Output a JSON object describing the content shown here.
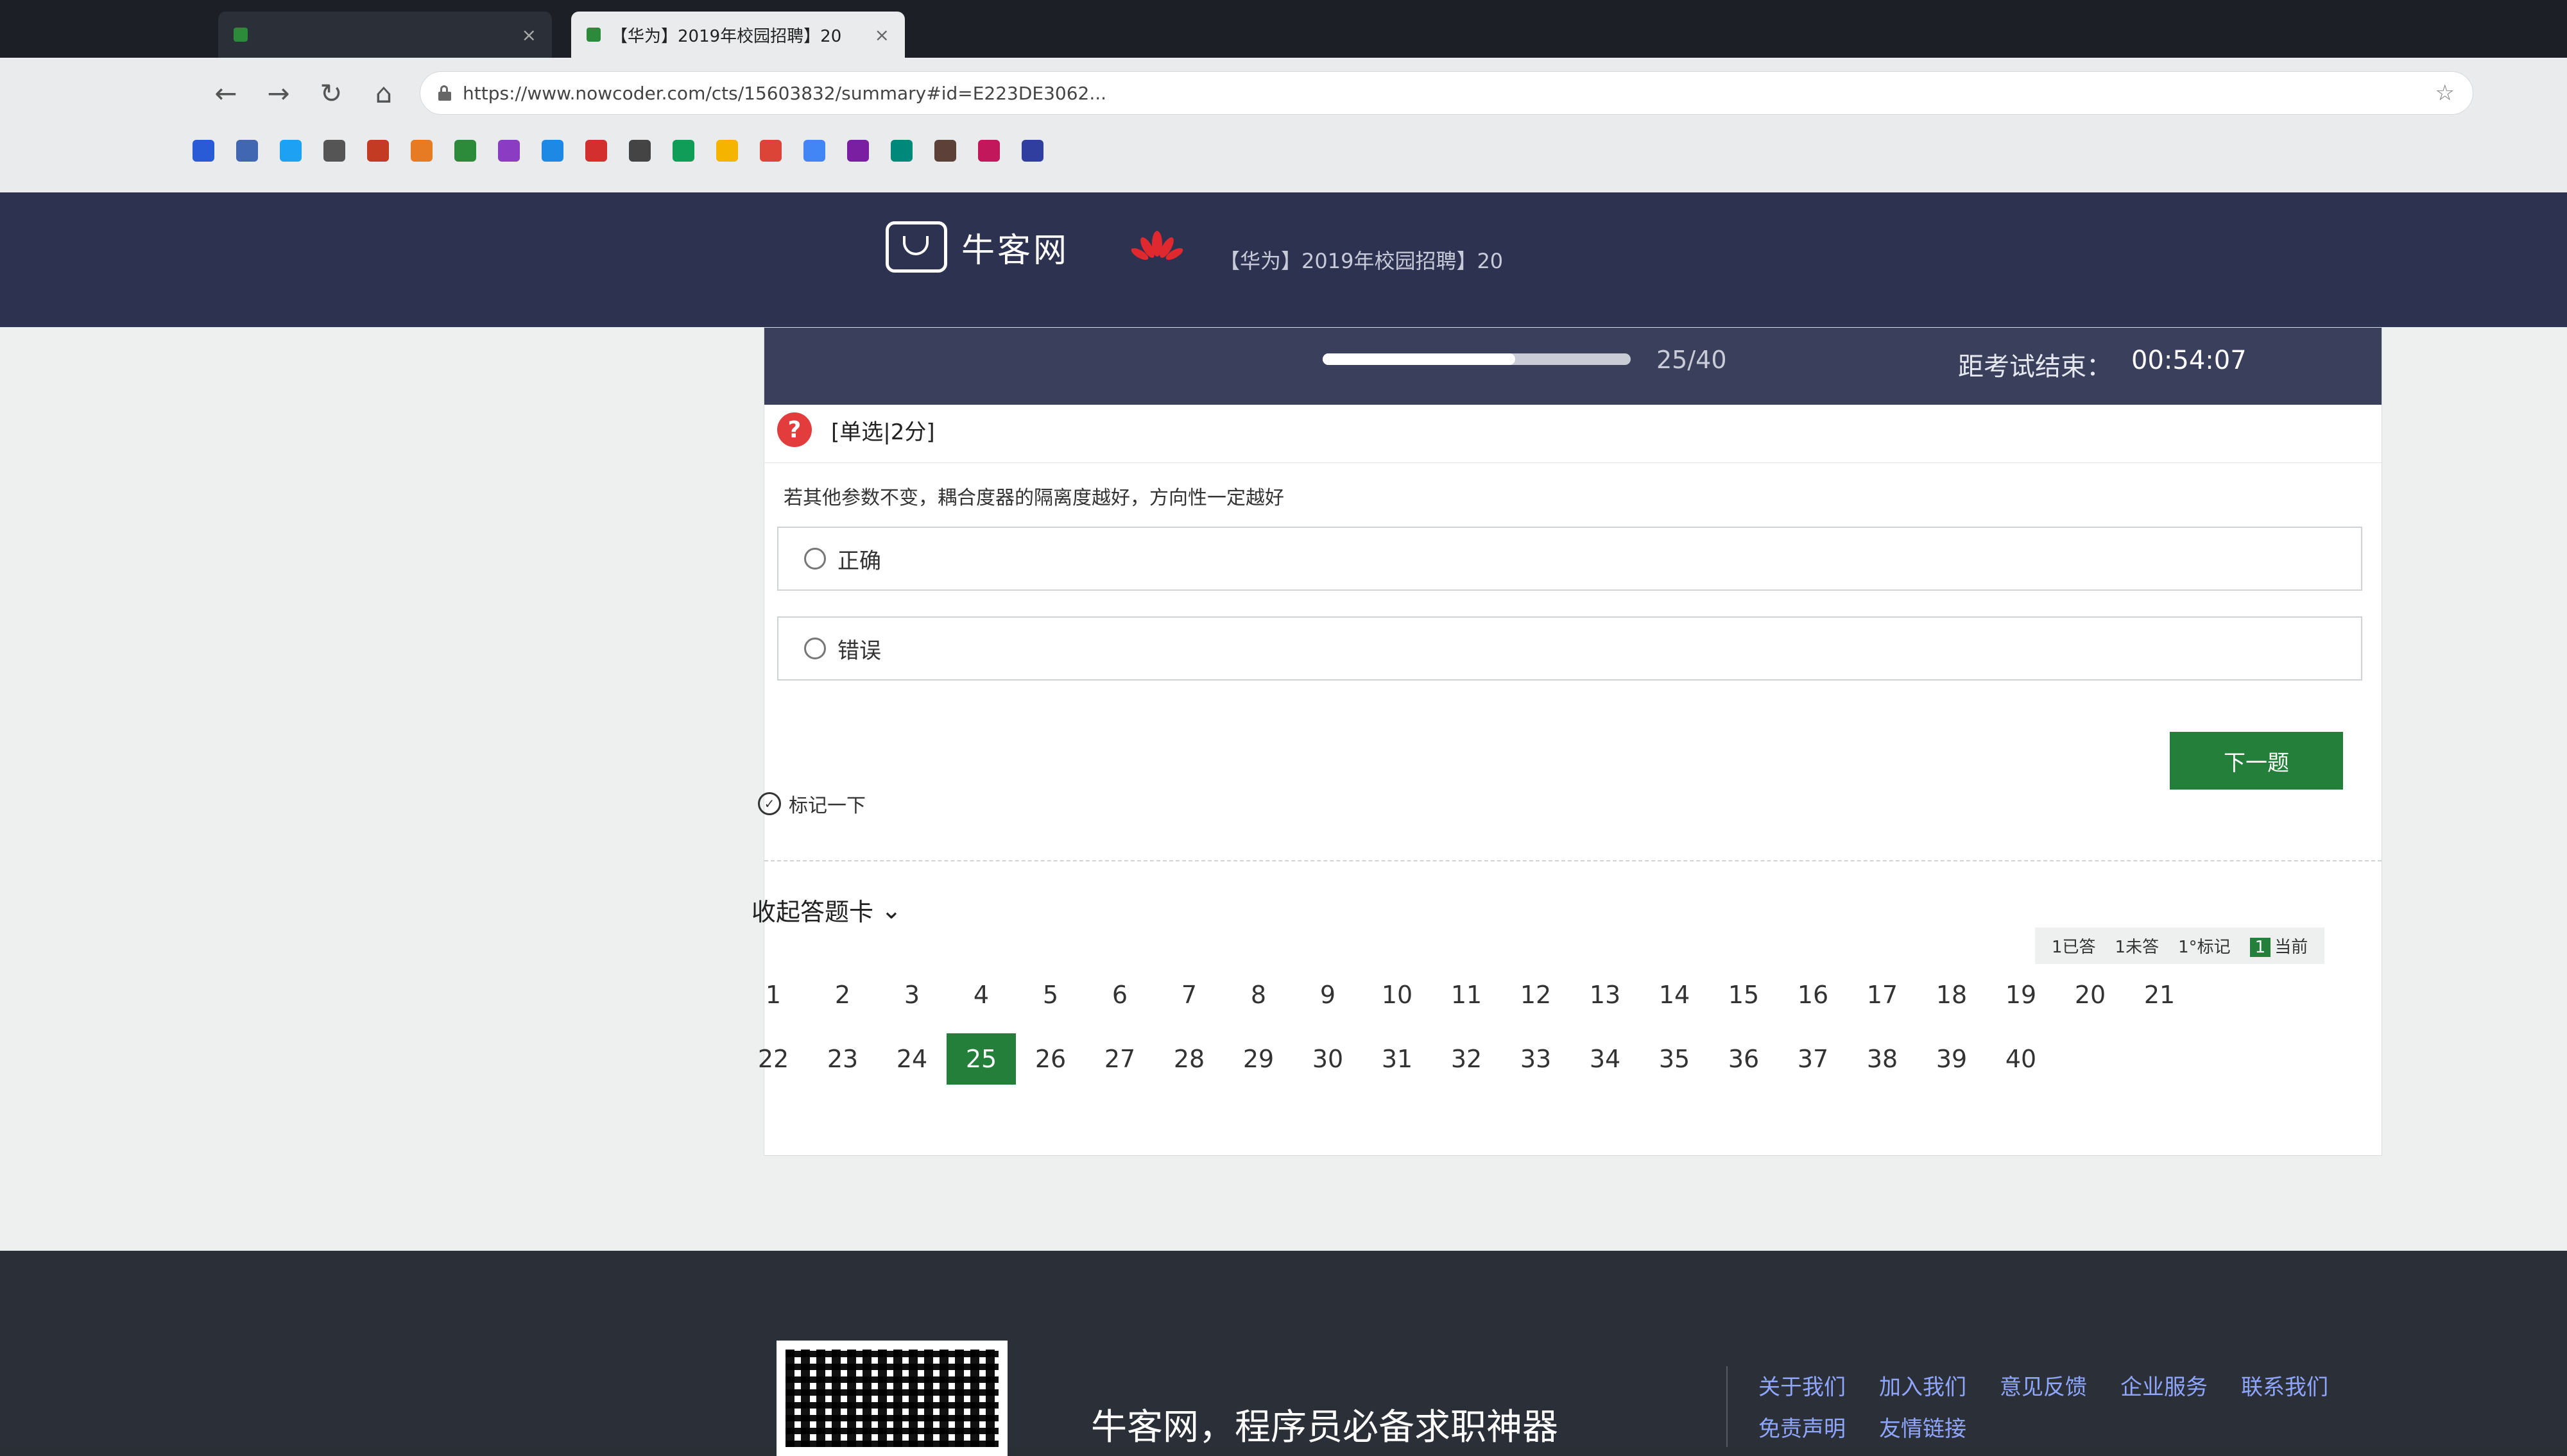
{
  "browser": {
    "tabs": [
      {
        "label": "",
        "active": false
      },
      {
        "label": "【华为】2019年校园招聘】20",
        "active": true
      }
    ],
    "url": "https://www.nowcoder.com/cts/15603832/summary#id=E223DE3062...",
    "bookmark_colors": [
      "#2a5bd7",
      "#4267b2",
      "#1da1f2",
      "#555",
      "#c23b22",
      "#e77b24",
      "#2c8a3b",
      "#8a3cc2",
      "#1e88e5",
      "#d32f2f",
      "#444",
      "#0f9d58",
      "#f4b400",
      "#db4437",
      "#4285f4",
      "#7b1fa2",
      "#00897b",
      "#5d4037",
      "#c2185b",
      "#303f9f"
    ]
  },
  "site": {
    "logo_text": "牛客网",
    "company_title": "【华为】2019年校园招聘】20"
  },
  "exam": {
    "progress_text": "25/40",
    "progress_fraction": 0.625,
    "timer_label": "距考试结束：",
    "timer_value": "00:54:07",
    "question_type": "[单选|2分]",
    "question_text": "若其他参数不变，耦合度器的隔离度越好，方向性一定越好",
    "options": [
      "正确",
      "错误"
    ],
    "next_label": "下一题",
    "mark_label": "标记一下",
    "collapse_label": "收起答题卡",
    "legend": {
      "answered": "1已答",
      "unanswered": "1未答",
      "marked": "1°标记",
      "current_num": "1",
      "current": "当前"
    },
    "numbers": [
      "1",
      "2",
      "3",
      "4",
      "5",
      "6",
      "7",
      "8",
      "9",
      "10",
      "11",
      "12",
      "13",
      "14",
      "15",
      "16",
      "17",
      "18",
      "19",
      "20",
      "21",
      "22",
      "23",
      "24",
      "25",
      "26",
      "27",
      "28",
      "29",
      "30",
      "31",
      "32",
      "33",
      "34",
      "35",
      "36",
      "37",
      "38",
      "39",
      "40"
    ],
    "current_number": "25"
  },
  "footer": {
    "slogan": "牛客网，程序员必备求职神器",
    "links_row1": [
      "关于我们",
      "加入我们",
      "意见反馈",
      "企业服务",
      "联系我们"
    ],
    "links_row2": [
      "免责声明",
      "友情链接"
    ]
  }
}
